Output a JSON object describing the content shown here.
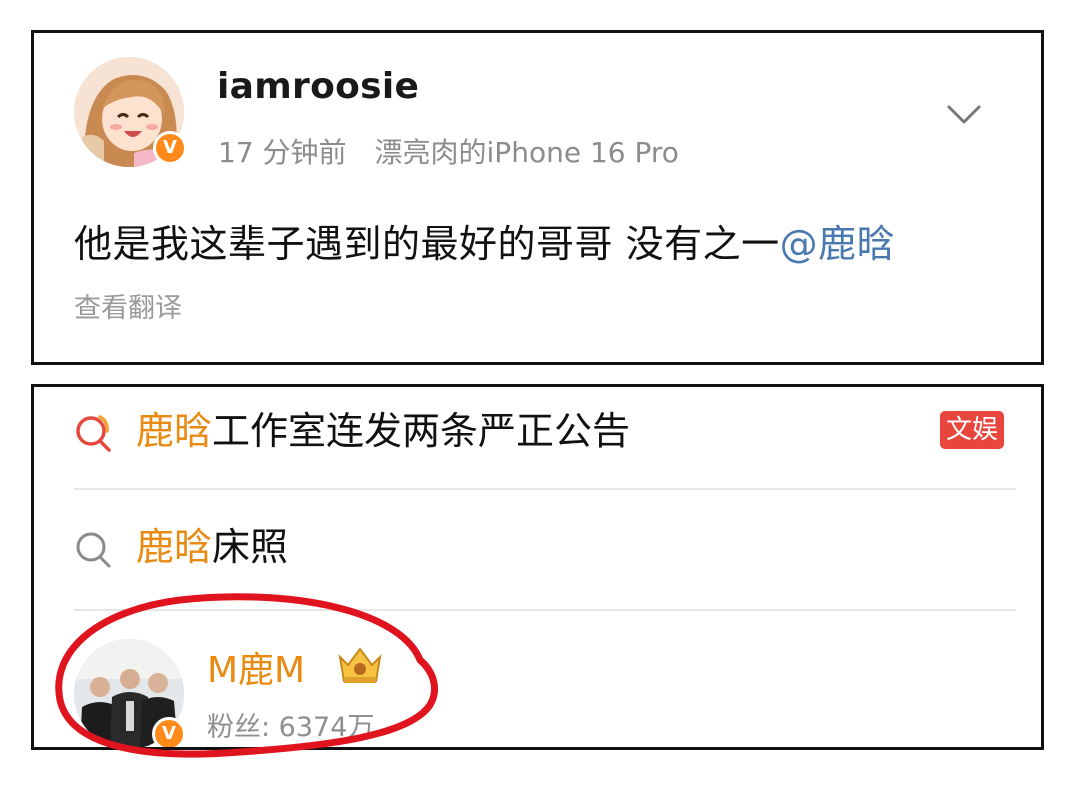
{
  "post": {
    "username": "iamroosie",
    "time": "17 分钟前",
    "device": "漂亮肉的iPhone 16 Pro",
    "text": "他是我这辈子遇到的最好的哥哥 没有之一",
    "mention": "@鹿晗",
    "translate_label": "查看翻译",
    "verified_badge": "V"
  },
  "search": {
    "results": [
      {
        "highlight": "鹿晗",
        "rest": "工作室连发两条严正公告",
        "tag": "文娱",
        "icon": "hot-search-icon"
      },
      {
        "highlight": "鹿晗",
        "rest": "床照",
        "icon": "search-icon"
      }
    ],
    "user": {
      "name": "M鹿M",
      "fans": "粉丝: 6374万",
      "verified_badge": "V",
      "icon": "crown-icon"
    }
  },
  "colors": {
    "highlight": "#e98a12",
    "mention": "#4a79b0",
    "tag_bg": "#e8453c",
    "badge": "#ff8a1a",
    "annotation": "#e0141e"
  }
}
